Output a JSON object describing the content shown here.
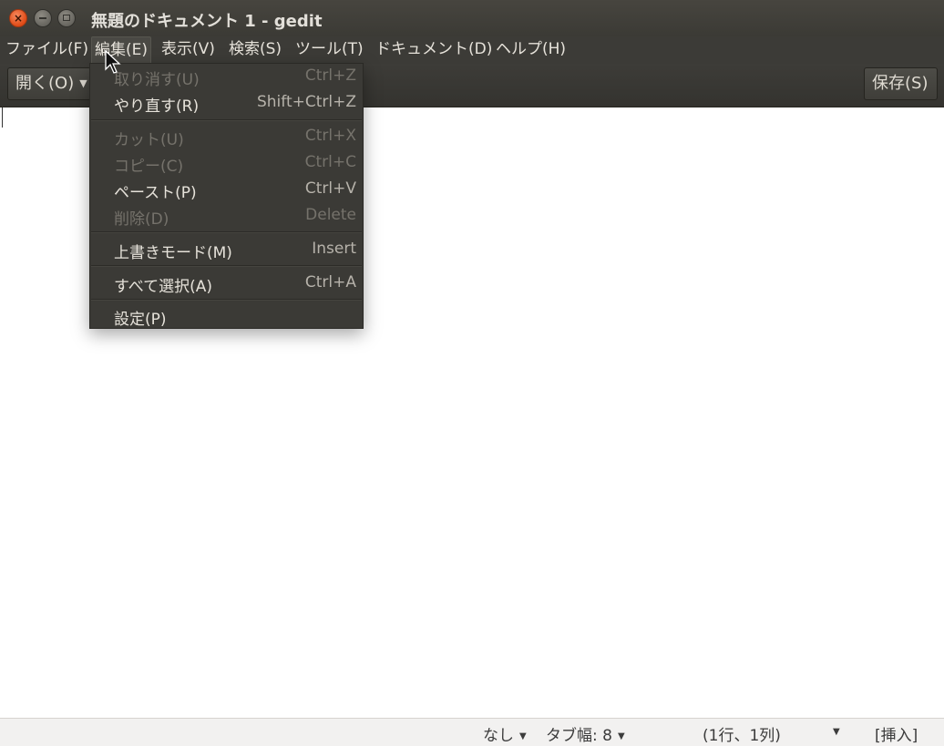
{
  "window": {
    "title": "無題のドキュメント 1 - gedit"
  },
  "menubar": {
    "items": [
      {
        "label": "ファイル(F)"
      },
      {
        "label": "編集(E)"
      },
      {
        "label": "表示(V)"
      },
      {
        "label": "検索(S)"
      },
      {
        "label": "ツール(T)"
      },
      {
        "label": "ドキュメント(D)"
      },
      {
        "label": "ヘルプ(H)"
      }
    ]
  },
  "toolbar": {
    "open_label": "開く(O)",
    "save_label": "保存(S)"
  },
  "edit_menu": {
    "items": [
      {
        "label": "取り消す(U)",
        "accel": "Ctrl+Z",
        "enabled": false
      },
      {
        "label": "やり直す(R)",
        "accel": "Shift+Ctrl+Z",
        "enabled": true
      },
      {
        "label": "カット(U)",
        "accel": "Ctrl+X",
        "enabled": false
      },
      {
        "label": "コピー(C)",
        "accel": "Ctrl+C",
        "enabled": false
      },
      {
        "label": "ペースト(P)",
        "accel": "Ctrl+V",
        "enabled": true
      },
      {
        "label": "削除(D)",
        "accel": "Delete",
        "enabled": false
      },
      {
        "label": "上書きモード(M)",
        "accel": "Insert",
        "enabled": true
      },
      {
        "label": "すべて選択(A)",
        "accel": "Ctrl+A",
        "enabled": true
      },
      {
        "label": "設定(P)",
        "accel": "",
        "enabled": true
      }
    ]
  },
  "statusbar": {
    "syntax": "なし",
    "tab_width": "タブ幅: 8",
    "position": "(1行、1列)",
    "mode": "[挿入]"
  },
  "icons": {
    "close": "close-icon",
    "minimize": "minimize-icon",
    "maximize": "maximize-icon",
    "dropdown": "chevron-down-icon",
    "pointer": "mouse-pointer-icon"
  },
  "colors": {
    "titlebar": "#3b3a35",
    "menu_bg": "#3b3a36",
    "close_button": "#df4a16",
    "statusbar_bg": "#f2f1f0"
  }
}
